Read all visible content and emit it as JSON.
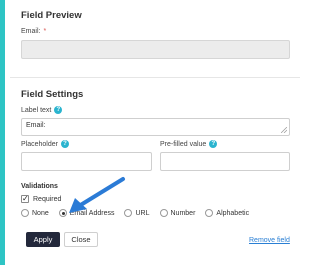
{
  "preview": {
    "title": "Field Preview",
    "email_label": "Email:",
    "required_mark": "*",
    "email_value": ""
  },
  "settings": {
    "title": "Field Settings",
    "label_text_label": "Label text",
    "label_text_value": "Email:",
    "placeholder_label": "Placeholder",
    "placeholder_value": "",
    "prefilled_label": "Pre-filled value",
    "prefilled_value": ""
  },
  "validations": {
    "title": "Validations",
    "required_label": "Required",
    "required_checked": true,
    "options": [
      "None",
      "Email Address",
      "URL",
      "Number",
      "Alphabetic"
    ],
    "selected": "Email Address"
  },
  "actions": {
    "apply_label": "Apply",
    "close_label": "Close",
    "remove_label": "Remove field"
  },
  "icons": {
    "help": "question-circle-icon",
    "arrow": "blue-arrow-annotation"
  },
  "colors": {
    "accent": "#2ec4c4",
    "help": "#2ab4cf",
    "apply_bg": "#23283b",
    "link": "#2a7fd4",
    "arrow": "#2b7bd6"
  }
}
